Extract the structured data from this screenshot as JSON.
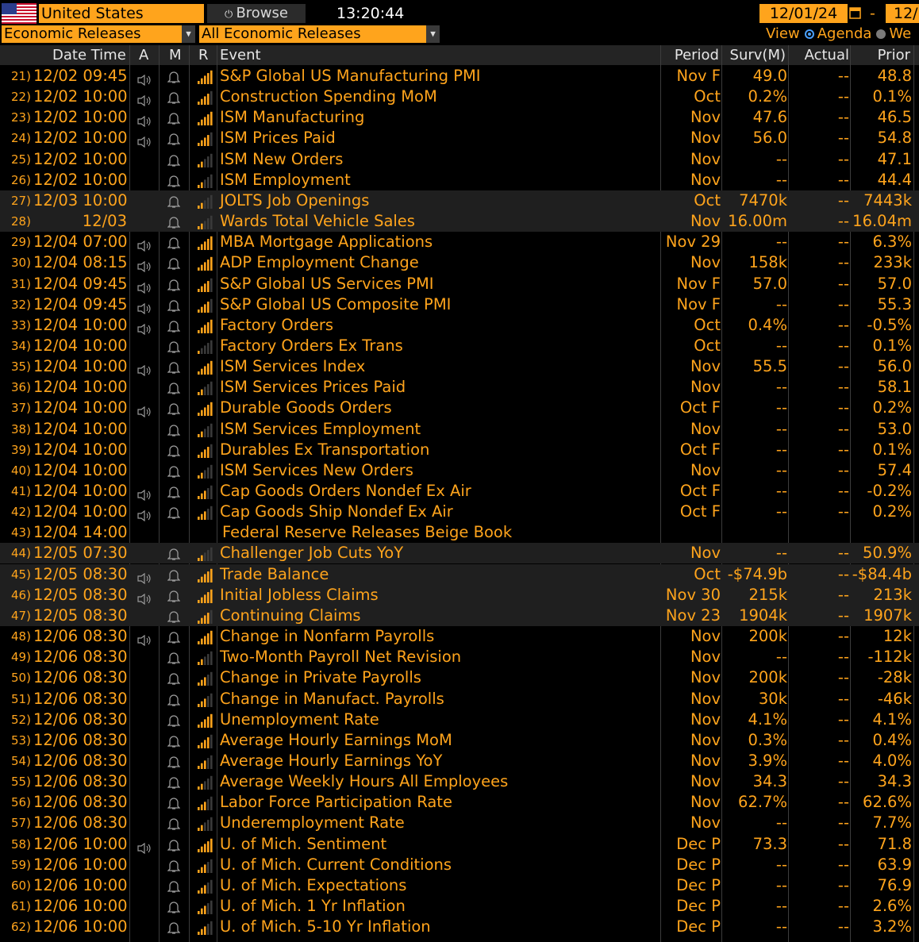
{
  "toolbar": {
    "country": "United States",
    "browse_label": "Browse",
    "time": "13:20:44",
    "start_date": "12/01/24",
    "date_separator": "-",
    "end_date": "12/",
    "category": "Economic Releases",
    "subcategory": "All Economic Releases",
    "view_label": "View",
    "view_agenda": "Agenda",
    "view_week": "We"
  },
  "columns": {
    "datetime": "Date Time",
    "a": "A",
    "m": "M",
    "r": "R",
    "event": "Event",
    "period": "Period",
    "surv": "Surv(M)",
    "actual": "Actual",
    "prior": "Prior"
  },
  "rows": [
    {
      "n": "21)",
      "dt": "12/02 09:45",
      "spk": true,
      "rel": 4,
      "event": "S&P Global US Manufacturing PMI",
      "period": "Nov F",
      "surv": "49.0",
      "actual": "--",
      "prior": "48.8",
      "shade": false
    },
    {
      "n": "22)",
      "dt": "12/02 10:00",
      "spk": true,
      "rel": 3,
      "event": "Construction Spending MoM",
      "period": "Oct",
      "surv": "0.2%",
      "actual": "--",
      "prior": "0.1%",
      "shade": false
    },
    {
      "n": "23)",
      "dt": "12/02 10:00",
      "spk": true,
      "rel": 4,
      "event": "ISM Manufacturing",
      "period": "Nov",
      "surv": "47.6",
      "actual": "--",
      "prior": "46.5",
      "shade": false
    },
    {
      "n": "24)",
      "dt": "12/02 10:00",
      "spk": true,
      "rel": 3,
      "event": "ISM Prices Paid",
      "period": "Nov",
      "surv": "56.0",
      "actual": "--",
      "prior": "54.8",
      "shade": false
    },
    {
      "n": "25)",
      "dt": "12/02 10:00",
      "spk": false,
      "rel": 1,
      "event": "ISM New Orders",
      "period": "Nov",
      "surv": "--",
      "actual": "--",
      "prior": "47.1",
      "shade": false
    },
    {
      "n": "26)",
      "dt": "12/02 10:00",
      "spk": false,
      "rel": 1,
      "event": "ISM Employment",
      "period": "Nov",
      "surv": "--",
      "actual": "--",
      "prior": "44.4",
      "shade": false
    },
    {
      "n": "27)",
      "dt": "12/03 10:00",
      "spk": false,
      "rel": 1,
      "event": "JOLTS Job Openings",
      "period": "Oct",
      "surv": "7470k",
      "actual": "--",
      "prior": "7443k",
      "shade": true
    },
    {
      "n": "28)",
      "dt": "12/03",
      "spk": false,
      "rel": 1,
      "event": "Wards Total Vehicle Sales",
      "period": "Nov",
      "surv": "16.00m",
      "actual": "--",
      "prior": "16.04m",
      "shade": true,
      "dateonly": true
    },
    {
      "n": "29)",
      "dt": "12/04 07:00",
      "spk": true,
      "rel": 4,
      "event": "MBA Mortgage Applications",
      "period": "Nov 29",
      "surv": "--",
      "actual": "--",
      "prior": "6.3%",
      "shade": false
    },
    {
      "n": "30)",
      "dt": "12/04 08:15",
      "spk": true,
      "rel": 4,
      "event": "ADP Employment Change",
      "period": "Nov",
      "surv": "158k",
      "actual": "--",
      "prior": "233k",
      "shade": false
    },
    {
      "n": "31)",
      "dt": "12/04 09:45",
      "spk": true,
      "rel": 3,
      "event": "S&P Global US Services PMI",
      "period": "Nov F",
      "surv": "57.0",
      "actual": "--",
      "prior": "57.0",
      "shade": false
    },
    {
      "n": "32)",
      "dt": "12/04 09:45",
      "spk": true,
      "rel": 3,
      "event": "S&P Global US Composite PMI",
      "period": "Nov F",
      "surv": "--",
      "actual": "--",
      "prior": "55.3",
      "shade": false
    },
    {
      "n": "33)",
      "dt": "12/04 10:00",
      "spk": true,
      "rel": 4,
      "event": "Factory Orders",
      "period": "Oct",
      "surv": "0.4%",
      "actual": "--",
      "prior": "-0.5%",
      "shade": false
    },
    {
      "n": "34)",
      "dt": "12/04 10:00",
      "spk": false,
      "rel": 0,
      "event": "Factory Orders Ex Trans",
      "period": "Oct",
      "surv": "--",
      "actual": "--",
      "prior": "0.1%",
      "shade": false
    },
    {
      "n": "35)",
      "dt": "12/04 10:00",
      "spk": true,
      "rel": 4,
      "event": "ISM Services Index",
      "period": "Nov",
      "surv": "55.5",
      "actual": "--",
      "prior": "56.0",
      "shade": false
    },
    {
      "n": "36)",
      "dt": "12/04 10:00",
      "spk": false,
      "rel": 1,
      "event": "ISM Services Prices Paid",
      "period": "Nov",
      "surv": "--",
      "actual": "--",
      "prior": "58.1",
      "shade": false
    },
    {
      "n": "37)",
      "dt": "12/04 10:00",
      "spk": true,
      "rel": 4,
      "event": "Durable Goods Orders",
      "period": "Oct F",
      "surv": "--",
      "actual": "--",
      "prior": "0.2%",
      "shade": false
    },
    {
      "n": "38)",
      "dt": "12/04 10:00",
      "spk": false,
      "rel": 1,
      "event": "ISM Services Employment",
      "period": "Nov",
      "surv": "--",
      "actual": "--",
      "prior": "53.0",
      "shade": false
    },
    {
      "n": "39)",
      "dt": "12/04 10:00",
      "spk": false,
      "rel": 3,
      "event": "Durables Ex Transportation",
      "period": "Oct F",
      "surv": "--",
      "actual": "--",
      "prior": "0.1%",
      "shade": false
    },
    {
      "n": "40)",
      "dt": "12/04 10:00",
      "spk": false,
      "rel": 1,
      "event": "ISM Services New Orders",
      "period": "Nov",
      "surv": "--",
      "actual": "--",
      "prior": "57.4",
      "shade": false
    },
    {
      "n": "41)",
      "dt": "12/04 10:00",
      "spk": true,
      "rel": 2,
      "event": "Cap Goods Orders Nondef Ex Air",
      "period": "Oct F",
      "surv": "--",
      "actual": "--",
      "prior": "-0.2%",
      "shade": false
    },
    {
      "n": "42)",
      "dt": "12/04 10:00",
      "spk": true,
      "rel": 2,
      "event": "Cap Goods Ship Nondef Ex Air",
      "period": "Oct F",
      "surv": "--",
      "actual": "--",
      "prior": "0.2%",
      "shade": false
    },
    {
      "n": "43)",
      "dt": "12/04 14:00",
      "spk": false,
      "rel": -1,
      "event": "Federal Reserve Releases Beige Book",
      "period": "",
      "surv": "",
      "actual": "",
      "prior": "",
      "shade": false,
      "fed": true
    },
    {
      "n": "44)",
      "dt": "12/05 07:30",
      "spk": false,
      "rel": 1,
      "event": "Challenger Job Cuts YoY",
      "period": "Nov",
      "surv": "--",
      "actual": "--",
      "prior": "50.9%",
      "shade": true
    },
    {
      "n": "45)",
      "dt": "12/05 08:30",
      "spk": true,
      "rel": 4,
      "event": "Trade Balance",
      "period": "Oct",
      "surv": "-$74.9b",
      "actual": "--",
      "prior": "-$84.4b",
      "shade": true
    },
    {
      "n": "46)",
      "dt": "12/05 08:30",
      "spk": true,
      "rel": 4,
      "event": "Initial Jobless Claims",
      "period": "Nov 30",
      "surv": "215k",
      "actual": "--",
      "prior": "213k",
      "shade": true
    },
    {
      "n": "47)",
      "dt": "12/05 08:30",
      "spk": false,
      "rel": 3,
      "event": "Continuing Claims",
      "period": "Nov 23",
      "surv": "1904k",
      "actual": "--",
      "prior": "1907k",
      "shade": true
    },
    {
      "n": "48)",
      "dt": "12/06 08:30",
      "spk": true,
      "rel": 4,
      "event": "Change in Nonfarm Payrolls",
      "period": "Nov",
      "surv": "200k",
      "actual": "--",
      "prior": "12k",
      "shade": false
    },
    {
      "n": "49)",
      "dt": "12/06 08:30",
      "spk": false,
      "rel": 1,
      "event": "Two-Month Payroll Net Revision",
      "period": "Nov",
      "surv": "--",
      "actual": "--",
      "prior": "-112k",
      "shade": false
    },
    {
      "n": "50)",
      "dt": "12/06 08:30",
      "spk": false,
      "rel": 2,
      "event": "Change in Private Payrolls",
      "period": "Nov",
      "surv": "200k",
      "actual": "--",
      "prior": "-28k",
      "shade": false
    },
    {
      "n": "51)",
      "dt": "12/06 08:30",
      "spk": false,
      "rel": 2,
      "event": "Change in Manufact. Payrolls",
      "period": "Nov",
      "surv": "30k",
      "actual": "--",
      "prior": "-46k",
      "shade": false
    },
    {
      "n": "52)",
      "dt": "12/06 08:30",
      "spk": false,
      "rel": 4,
      "event": "Unemployment Rate",
      "period": "Nov",
      "surv": "4.1%",
      "actual": "--",
      "prior": "4.1%",
      "shade": false
    },
    {
      "n": "53)",
      "dt": "12/06 08:30",
      "spk": false,
      "rel": 3,
      "event": "Average Hourly Earnings MoM",
      "period": "Nov",
      "surv": "0.3%",
      "actual": "--",
      "prior": "0.4%",
      "shade": false
    },
    {
      "n": "54)",
      "dt": "12/06 08:30",
      "spk": false,
      "rel": 2,
      "event": "Average Hourly Earnings YoY",
      "period": "Nov",
      "surv": "3.9%",
      "actual": "--",
      "prior": "4.0%",
      "shade": false
    },
    {
      "n": "55)",
      "dt": "12/06 08:30",
      "spk": false,
      "rel": 1,
      "event": "Average Weekly Hours All Employees",
      "period": "Nov",
      "surv": "34.3",
      "actual": "--",
      "prior": "34.3",
      "shade": false
    },
    {
      "n": "56)",
      "dt": "12/06 08:30",
      "spk": false,
      "rel": 2,
      "event": "Labor Force Participation Rate",
      "period": "Nov",
      "surv": "62.7%",
      "actual": "--",
      "prior": "62.6%",
      "shade": false
    },
    {
      "n": "57)",
      "dt": "12/06 08:30",
      "spk": false,
      "rel": 1,
      "event": "Underemployment Rate",
      "period": "Nov",
      "surv": "--",
      "actual": "--",
      "prior": "7.7%",
      "shade": false
    },
    {
      "n": "58)",
      "dt": "12/06 10:00",
      "spk": true,
      "rel": 4,
      "event": "U. of Mich. Sentiment",
      "period": "Dec P",
      "surv": "73.3",
      "actual": "--",
      "prior": "71.8",
      "shade": false
    },
    {
      "n": "59)",
      "dt": "12/06 10:00",
      "spk": false,
      "rel": 2,
      "event": "U. of Mich. Current Conditions",
      "period": "Dec P",
      "surv": "--",
      "actual": "--",
      "prior": "63.9",
      "shade": false
    },
    {
      "n": "60)",
      "dt": "12/06 10:00",
      "spk": false,
      "rel": 2,
      "event": "U. of Mich. Expectations",
      "period": "Dec P",
      "surv": "--",
      "actual": "--",
      "prior": "76.9",
      "shade": false
    },
    {
      "n": "61)",
      "dt": "12/06 10:00",
      "spk": false,
      "rel": 2,
      "event": "U. of Mich. 1 Yr Inflation",
      "period": "Dec P",
      "surv": "--",
      "actual": "--",
      "prior": "2.6%",
      "shade": false
    },
    {
      "n": "62)",
      "dt": "12/06 10:00",
      "spk": false,
      "rel": 2,
      "event": "U. of Mich. 5-10 Yr Inflation",
      "period": "Dec P",
      "surv": "--",
      "actual": "--",
      "prior": "3.2%",
      "shade": false
    }
  ],
  "colors": {
    "accent": "#ffa41c",
    "text": "#ff9e1b",
    "shade": "#1f1f1f",
    "header": "#242424",
    "bar_on": "#ffa41c",
    "bar_off": "#3a3a3a"
  },
  "icons": {
    "speaker": "speaker-icon",
    "bell": "bell-icon",
    "relevance": "relevance-bars-icon",
    "flag": "us-flag-icon",
    "calendar": "calendar-icon"
  }
}
